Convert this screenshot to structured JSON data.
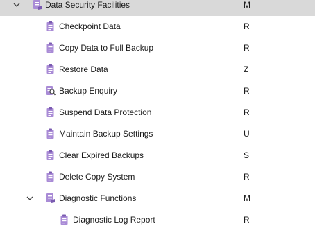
{
  "tree": {
    "root": {
      "label": "Data Security Facilities",
      "code": "M",
      "icon": "folder-document-icon",
      "expanded": true
    },
    "items": [
      {
        "label": "Checkpoint Data",
        "code": "R",
        "icon": "clipboard-icon"
      },
      {
        "label": "Copy Data to Full Backup",
        "code": "R",
        "icon": "clipboard-icon"
      },
      {
        "label": "Restore Data",
        "code": "Z",
        "icon": "clipboard-icon"
      },
      {
        "label": "Backup Enquiry",
        "code": "R",
        "icon": "enquiry-document-icon"
      },
      {
        "label": "Suspend Data Protection",
        "code": "R",
        "icon": "clipboard-icon"
      },
      {
        "label": "Maintain Backup Settings",
        "code": "U",
        "icon": "clipboard-icon"
      },
      {
        "label": "Clear Expired Backups",
        "code": "S",
        "icon": "clipboard-icon"
      },
      {
        "label": "Delete Copy System",
        "code": "R",
        "icon": "clipboard-icon"
      }
    ],
    "group": {
      "label": "Diagnostic Functions",
      "code": "M",
      "icon": "folder-document-icon",
      "expanded": true
    },
    "group_items": [
      {
        "label": "Diagnostic Log Report",
        "code": "R",
        "icon": "clipboard-icon"
      }
    ]
  },
  "colors": {
    "icon": "#a98bd6",
    "icon_dark": "#7a5bb0",
    "selection_bg": "#d9d9d9",
    "selection_border": "#5b9bd5"
  }
}
